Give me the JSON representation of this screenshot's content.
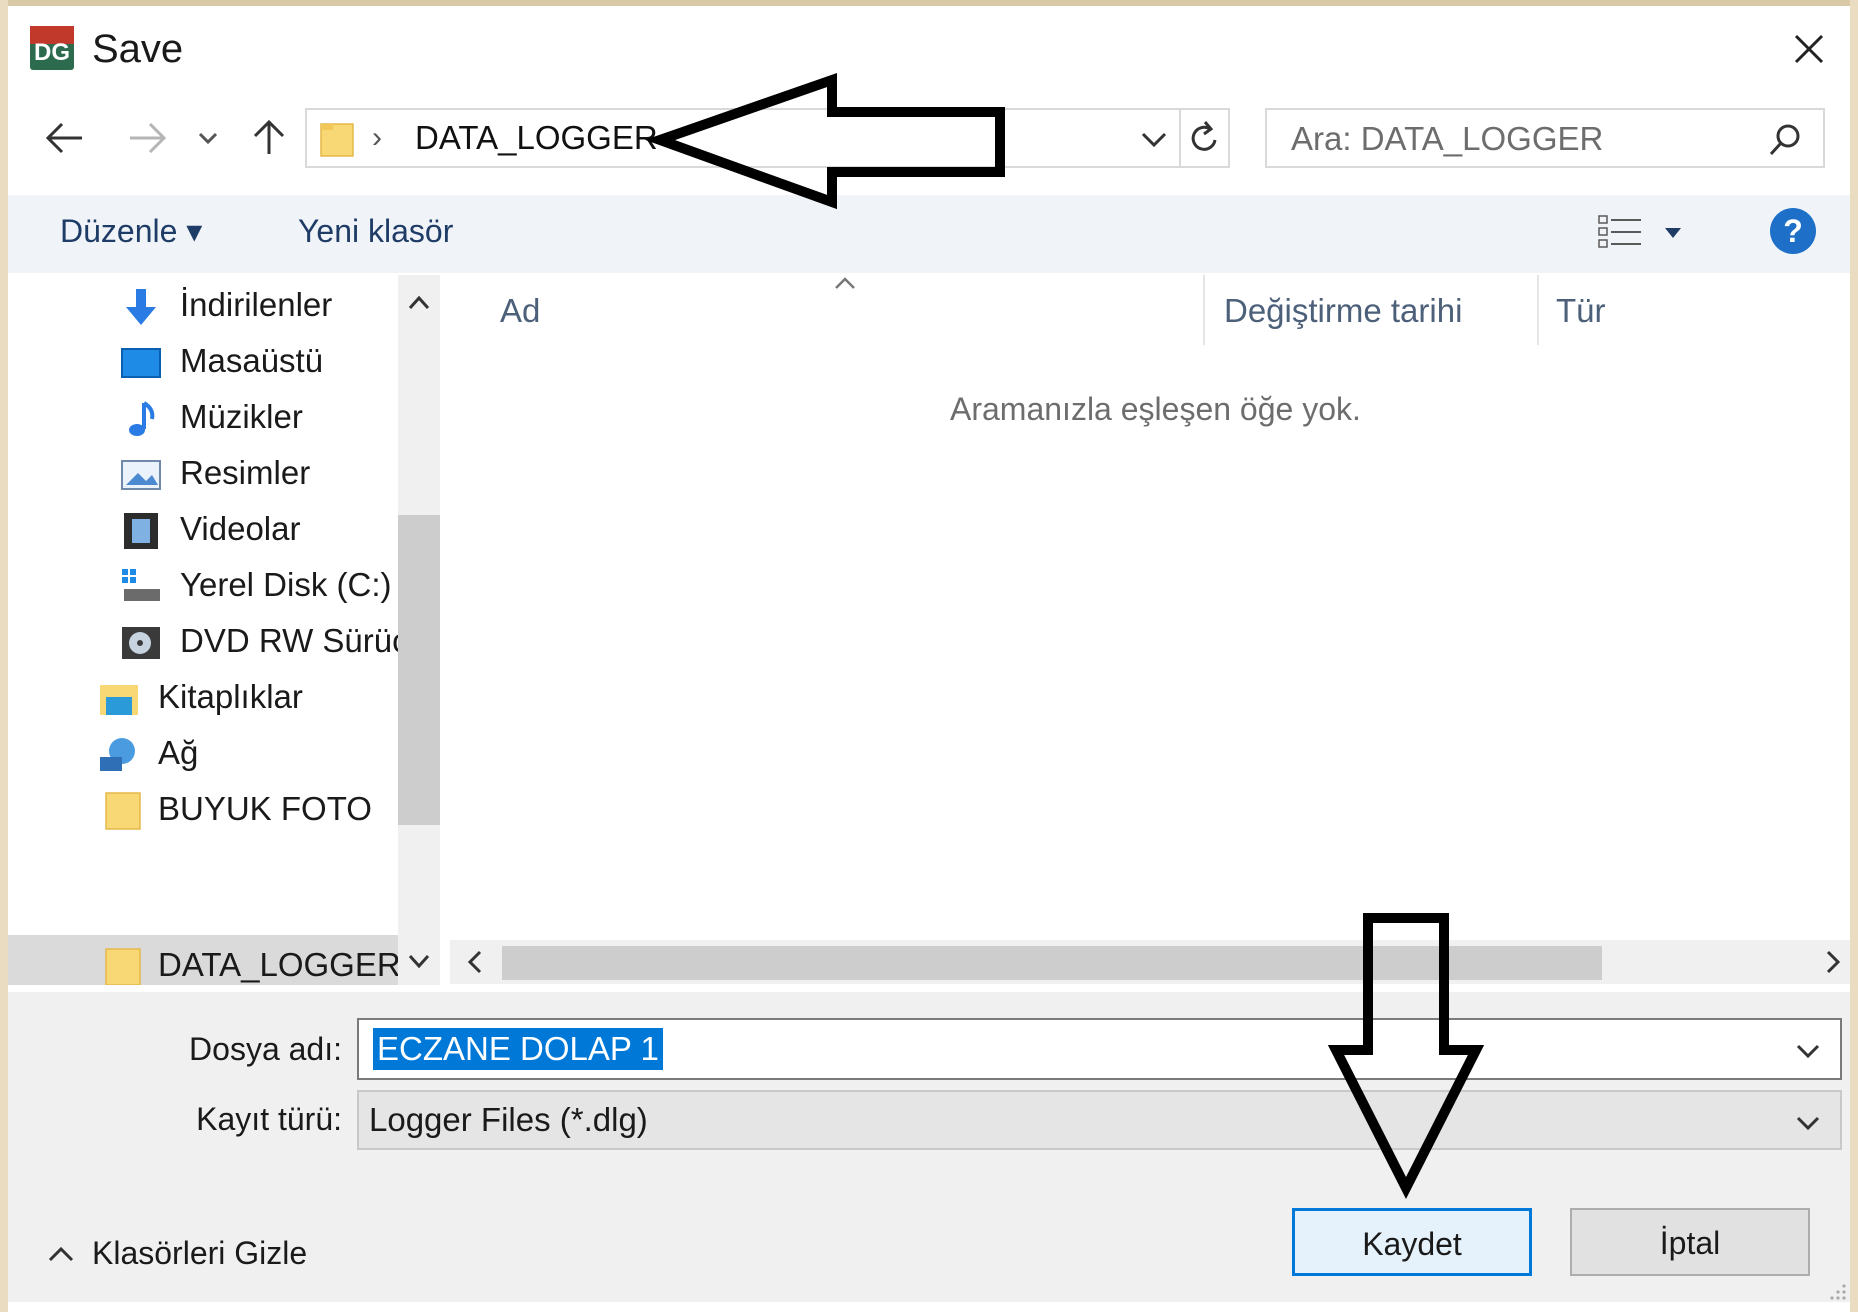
{
  "window": {
    "title": "Save",
    "app_icon_text": "DG"
  },
  "nav": {
    "back_icon": "arrow-left-icon",
    "forward_icon": "arrow-right-icon",
    "recent_icon": "chevron-down-icon",
    "up_icon": "arrow-up-icon"
  },
  "address": {
    "separator": "›",
    "folder": "DATA_LOGGER"
  },
  "search": {
    "placeholder": "Ara: DATA_LOGGER"
  },
  "toolbar": {
    "organize_label": "Düzenle ▾",
    "new_folder_label": "Yeni klasör"
  },
  "sidebar": {
    "items": [
      {
        "label": "İndirilenler",
        "icon": "download-icon"
      },
      {
        "label": "Masaüstü",
        "icon": "desktop-icon"
      },
      {
        "label": "Müzikler",
        "icon": "music-icon"
      },
      {
        "label": "Resimler",
        "icon": "pictures-icon"
      },
      {
        "label": "Videolar",
        "icon": "video-icon"
      },
      {
        "label": "Yerel Disk (C:)",
        "icon": "drive-icon"
      },
      {
        "label": "DVD RW Sürüc",
        "icon": "dvd-icon"
      },
      {
        "label": "Kitaplıklar",
        "icon": "libraries-icon"
      },
      {
        "label": "Ağ",
        "icon": "network-icon"
      },
      {
        "label": "BUYUK FOTO",
        "icon": "folder-icon"
      },
      {
        "label": "DATA_LOGGER",
        "icon": "folder-icon"
      }
    ]
  },
  "files": {
    "columns": [
      "Ad",
      "Değiştirme tarihi",
      "Tür"
    ],
    "empty_message": "Aramanızla eşleşen öğe yok."
  },
  "form": {
    "filename_label": "Dosya adı:",
    "filename_value": "ECZANE DOLAP 1",
    "filetype_label": "Kayıt türü:",
    "filetype_value": "Logger Files (*.dlg)"
  },
  "footer": {
    "hide_folders_label": "Klasörleri Gizle",
    "save_label": "Kaydet",
    "cancel_label": "İptal"
  },
  "colors": {
    "accent": "#0078d7",
    "toolbar_bg": "#f0f4f9",
    "selection": "#dadada"
  }
}
